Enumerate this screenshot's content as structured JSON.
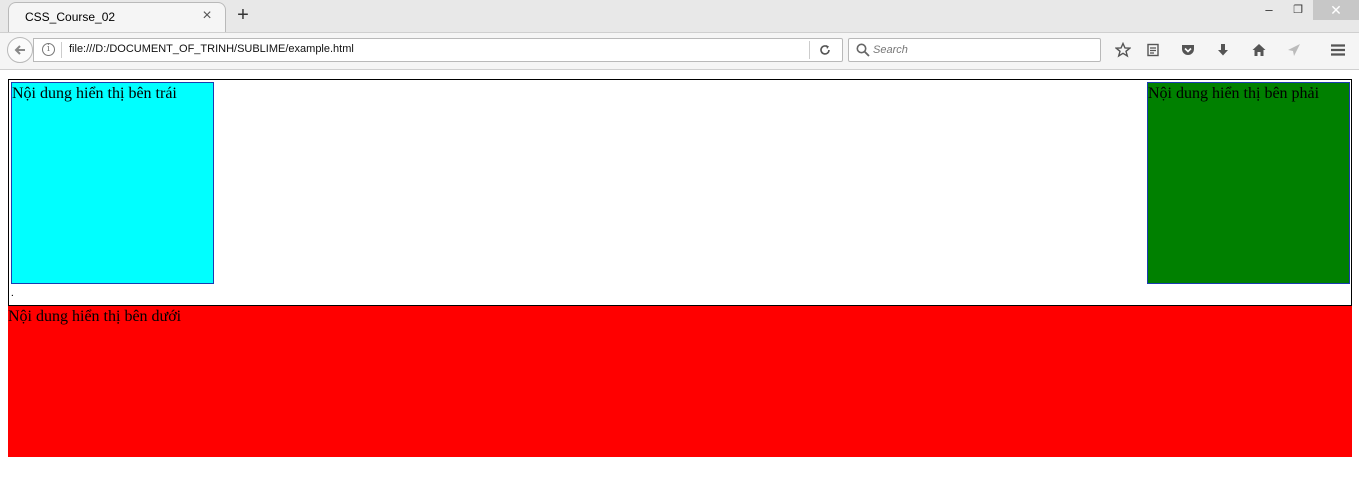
{
  "browser": {
    "tab_title": "CSS_Course_02",
    "tab_close": "×",
    "new_tab": "+",
    "window_controls": {
      "minimize": "‒",
      "maximize": "❐",
      "close": "✕"
    },
    "url": "file:///D:/DOCUMENT_OF_TRINH/SUBLIME/example.html",
    "search_placeholder": "Search",
    "toolbar_icons": [
      "star-icon",
      "reading-list-icon",
      "pocket-icon",
      "download-icon",
      "home-icon",
      "share-icon",
      "menu-icon"
    ]
  },
  "page": {
    "left_box": {
      "text": "Nội dung hiển thị bên trái",
      "color": "#00ffff"
    },
    "right_box": {
      "text": "Nội dung hiển thị bên phải",
      "color": "#008000"
    },
    "clear_text": ".",
    "bottom_box": {
      "text": "Nội dung hiển thị bên dưới",
      "color": "#ff0000"
    }
  }
}
